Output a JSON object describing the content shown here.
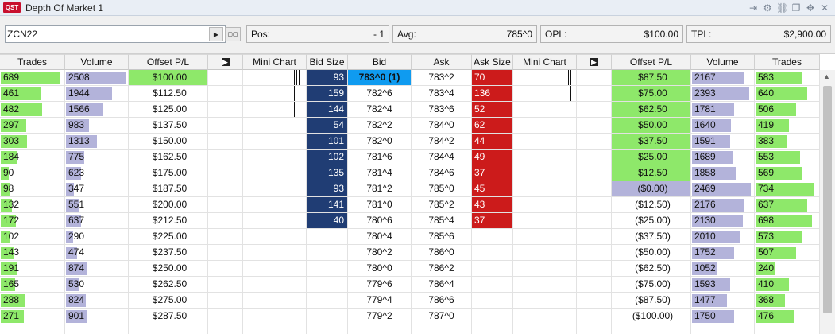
{
  "window": {
    "title": "Depth Of Market 1",
    "logo_text": "QST"
  },
  "titlebar_icons": [
    "pin-icon",
    "gear-icon",
    "link-icon",
    "restore-icon",
    "crosshair-icon",
    "close-icon"
  ],
  "toolbar": {
    "symbol_value": "ZCN22",
    "pos_label": "Pos:",
    "pos_value": "- 1",
    "avg_label": "Avg:",
    "avg_value": "785^0",
    "opl_label": "OPL:",
    "opl_value": "$100.00",
    "tpl_label": "TPL:",
    "tpl_value": "$2,900.00"
  },
  "headers": [
    "Trades",
    "Volume",
    "Offset P/L",
    "",
    "Mini Chart",
    "Bid Size",
    "Bid",
    "Ask",
    "Ask Size",
    "Mini Chart",
    "",
    "Offset P/L",
    "Volume",
    "Trades"
  ],
  "colors": {
    "bid_size": "#203d74",
    "ask_size": "#cc1b1b",
    "bar_green": "#8ee86a",
    "bar_purple": "#b3b3da",
    "bid_highlight": "#0f9bf0"
  },
  "rows": [
    {
      "lt": "689",
      "lv": "2508",
      "lpl": "$100.00",
      "bs": "93",
      "bid": "783^0 (1)",
      "ask": "783^2",
      "as": "70",
      "rpl": "$87.50",
      "rv": "2167",
      "rt": "583"
    },
    {
      "lt": "461",
      "lv": "1944",
      "lpl": "$112.50",
      "bs": "159",
      "bid": "782^6",
      "ask": "783^4",
      "as": "136",
      "rpl": "$75.00",
      "rv": "2393",
      "rt": "640"
    },
    {
      "lt": "482",
      "lv": "1566",
      "lpl": "$125.00",
      "bs": "144",
      "bid": "782^4",
      "ask": "783^6",
      "as": "52",
      "rpl": "$62.50",
      "rv": "1781",
      "rt": "506"
    },
    {
      "lt": "297",
      "lv": "983",
      "lpl": "$137.50",
      "bs": "54",
      "bid": "782^2",
      "ask": "784^0",
      "as": "62",
      "rpl": "$50.00",
      "rv": "1640",
      "rt": "419"
    },
    {
      "lt": "303",
      "lv": "1313",
      "lpl": "$150.00",
      "bs": "101",
      "bid": "782^0",
      "ask": "784^2",
      "as": "44",
      "rpl": "$37.50",
      "rv": "1591",
      "rt": "383"
    },
    {
      "lt": "184",
      "lv": "775",
      "lpl": "$162.50",
      "bs": "102",
      "bid": "781^6",
      "ask": "784^4",
      "as": "49",
      "rpl": "$25.00",
      "rv": "1689",
      "rt": "553"
    },
    {
      "lt": "90",
      "lv": "623",
      "lpl": "$175.00",
      "bs": "135",
      "bid": "781^4",
      "ask": "784^6",
      "as": "37",
      "rpl": "$12.50",
      "rv": "1858",
      "rt": "569"
    },
    {
      "lt": "98",
      "lv": "347",
      "lpl": "$187.50",
      "bs": "93",
      "bid": "781^2",
      "ask": "785^0",
      "as": "45",
      "rpl": "($0.00)",
      "rv": "2469",
      "rt": "734"
    },
    {
      "lt": "132",
      "lv": "551",
      "lpl": "$200.00",
      "bs": "141",
      "bid": "781^0",
      "ask": "785^2",
      "as": "43",
      "rpl": "($12.50)",
      "rv": "2176",
      "rt": "637"
    },
    {
      "lt": "172",
      "lv": "637",
      "lpl": "$212.50",
      "bs": "40",
      "bid": "780^6",
      "ask": "785^4",
      "as": "37",
      "rpl": "($25.00)",
      "rv": "2130",
      "rt": "698"
    },
    {
      "lt": "102",
      "lv": "290",
      "lpl": "$225.00",
      "bs": "",
      "bid": "780^4",
      "ask": "785^6",
      "as": "",
      "rpl": "($37.50)",
      "rv": "2010",
      "rt": "573"
    },
    {
      "lt": "143",
      "lv": "474",
      "lpl": "$237.50",
      "bs": "",
      "bid": "780^2",
      "ask": "786^0",
      "as": "",
      "rpl": "($50.00)",
      "rv": "1752",
      "rt": "507"
    },
    {
      "lt": "191",
      "lv": "874",
      "lpl": "$250.00",
      "bs": "",
      "bid": "780^0",
      "ask": "786^2",
      "as": "",
      "rpl": "($62.50)",
      "rv": "1052",
      "rt": "240"
    },
    {
      "lt": "165",
      "lv": "530",
      "lpl": "$262.50",
      "bs": "",
      "bid": "779^6",
      "ask": "786^4",
      "as": "",
      "rpl": "($75.00)",
      "rv": "1593",
      "rt": "410"
    },
    {
      "lt": "288",
      "lv": "824",
      "lpl": "$275.00",
      "bs": "",
      "bid": "779^4",
      "ask": "786^6",
      "as": "",
      "rpl": "($87.50)",
      "rv": "1477",
      "rt": "368"
    },
    {
      "lt": "271",
      "lv": "901",
      "lpl": "$287.50",
      "bs": "",
      "bid": "779^2",
      "ask": "787^0",
      "as": "",
      "rpl": "($100.00)",
      "rv": "1750",
      "rt": "476"
    },
    {
      "lt": "",
      "lv": "",
      "lpl": "",
      "bs": "",
      "bid": "",
      "ask": "",
      "as": "",
      "rpl": "",
      "rv": "",
      "rt": ""
    }
  ]
}
